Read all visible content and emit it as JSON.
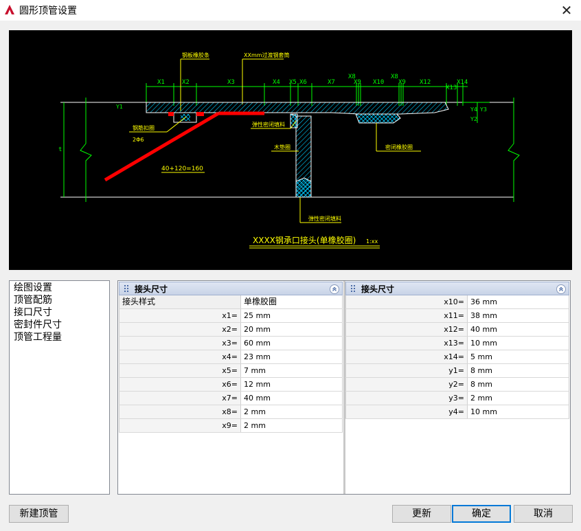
{
  "window": {
    "title": "圆形顶管设置",
    "close_glyph": "✕"
  },
  "drawing": {
    "labels": {
      "rubber_strip": "钢板橡胶条",
      "steel_ring": "XXmm过渡钢套筒",
      "steel_ring_bottom": "钢筋扣圈",
      "rebar": "2Φ6",
      "calc": "40+120=160",
      "seal_filler": "弹性密闭填料",
      "wood_pad": "木垫圈",
      "seal_rubber": "密闭橡胶圈",
      "seal_filler_bottom": "弹性密闭填料",
      "caption_main": "XXXX钢承口接头(单橡胶圈)",
      "caption_scale": "1:xx",
      "t": "t",
      "y1": "Y1",
      "y2": "Y2",
      "y3": "Y3",
      "y4": "Y4"
    },
    "dims": [
      "X1",
      "X2",
      "X3",
      "X4",
      "X5",
      "X6",
      "X7",
      "X8",
      "X9",
      "X10",
      "X8",
      "X9",
      "X12",
      "X13",
      "X14"
    ]
  },
  "nav": {
    "items": [
      "绘图设置",
      "顶管配筋",
      "接口尺寸",
      "密封件尺寸",
      "顶管工程量"
    ]
  },
  "left_panel": {
    "header": "接头尺寸",
    "rows": [
      {
        "label": "接头样式",
        "value": "单橡胶圈"
      },
      {
        "label": "x1=",
        "value": "25  mm"
      },
      {
        "label": "x2=",
        "value": "20  mm"
      },
      {
        "label": "x3=",
        "value": "60  mm"
      },
      {
        "label": "x4=",
        "value": "23  mm"
      },
      {
        "label": "x5=",
        "value": "7  mm"
      },
      {
        "label": "x6=",
        "value": "12  mm"
      },
      {
        "label": "x7=",
        "value": "40  mm"
      },
      {
        "label": "x8=",
        "value": "2  mm"
      },
      {
        "label": "x9=",
        "value": "2  mm"
      }
    ]
  },
  "right_panel": {
    "header": "接头尺寸",
    "rows": [
      {
        "label": "x10=",
        "value": "36  mm"
      },
      {
        "label": "x11=",
        "value": "38  mm"
      },
      {
        "label": "x12=",
        "value": "40  mm"
      },
      {
        "label": "x13=",
        "value": "10  mm"
      },
      {
        "label": "x14=",
        "value": "5  mm"
      },
      {
        "label": "y1=",
        "value": "8  mm"
      },
      {
        "label": "y2=",
        "value": "8  mm"
      },
      {
        "label": "y3=",
        "value": "2  mm"
      },
      {
        "label": "y4=",
        "value": "10  mm"
      }
    ]
  },
  "buttons": {
    "new_pipe": "新建顶管",
    "update": "更新",
    "ok": "确定",
    "cancel": "取消"
  },
  "colors": {
    "cad_background": "#000000",
    "cad_green": "#00ff00",
    "cad_yellow": "#ffff00",
    "cad_cyan": "#00ccff",
    "cad_red": "#ff0000",
    "accent": "#0078d7"
  }
}
